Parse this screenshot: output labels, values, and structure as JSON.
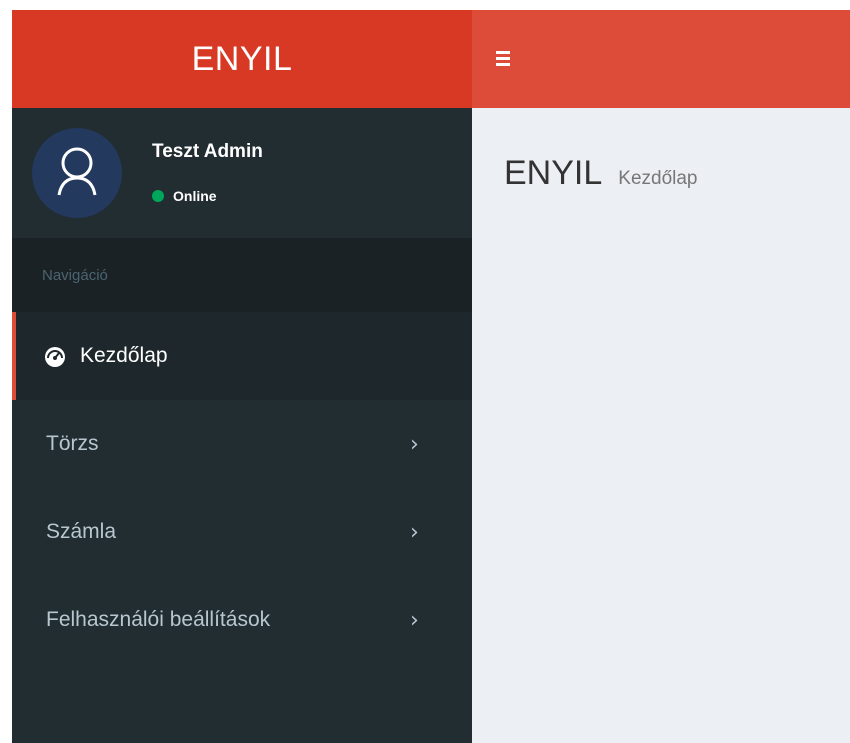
{
  "header": {
    "logo": "ENYIL",
    "toggle_icon": "hamburger-icon"
  },
  "sidebar": {
    "user": {
      "name": "Teszt Admin",
      "status": "Online",
      "avatar_icon": "user-icon"
    },
    "nav_header": "Navigáció",
    "items": [
      {
        "label": "Kezdőlap",
        "icon": "dashboard-icon",
        "active": true
      },
      {
        "label": "Törzs",
        "icon": "chevron-right-icon",
        "active": false
      },
      {
        "label": "Számla",
        "icon": "chevron-right-icon",
        "active": false
      },
      {
        "label": "Felhasználói beállítások",
        "icon": "chevron-right-icon",
        "active": false
      }
    ]
  },
  "content": {
    "title": "ENYIL",
    "subtitle": "Kezdőlap"
  },
  "colors": {
    "logo_bg": "#d73925",
    "navbar_bg": "#dd4b39",
    "sidebar_bg": "#222d32",
    "active_border": "#dd4b39",
    "status_online": "#00a65a",
    "content_bg": "#ecf0f5"
  }
}
